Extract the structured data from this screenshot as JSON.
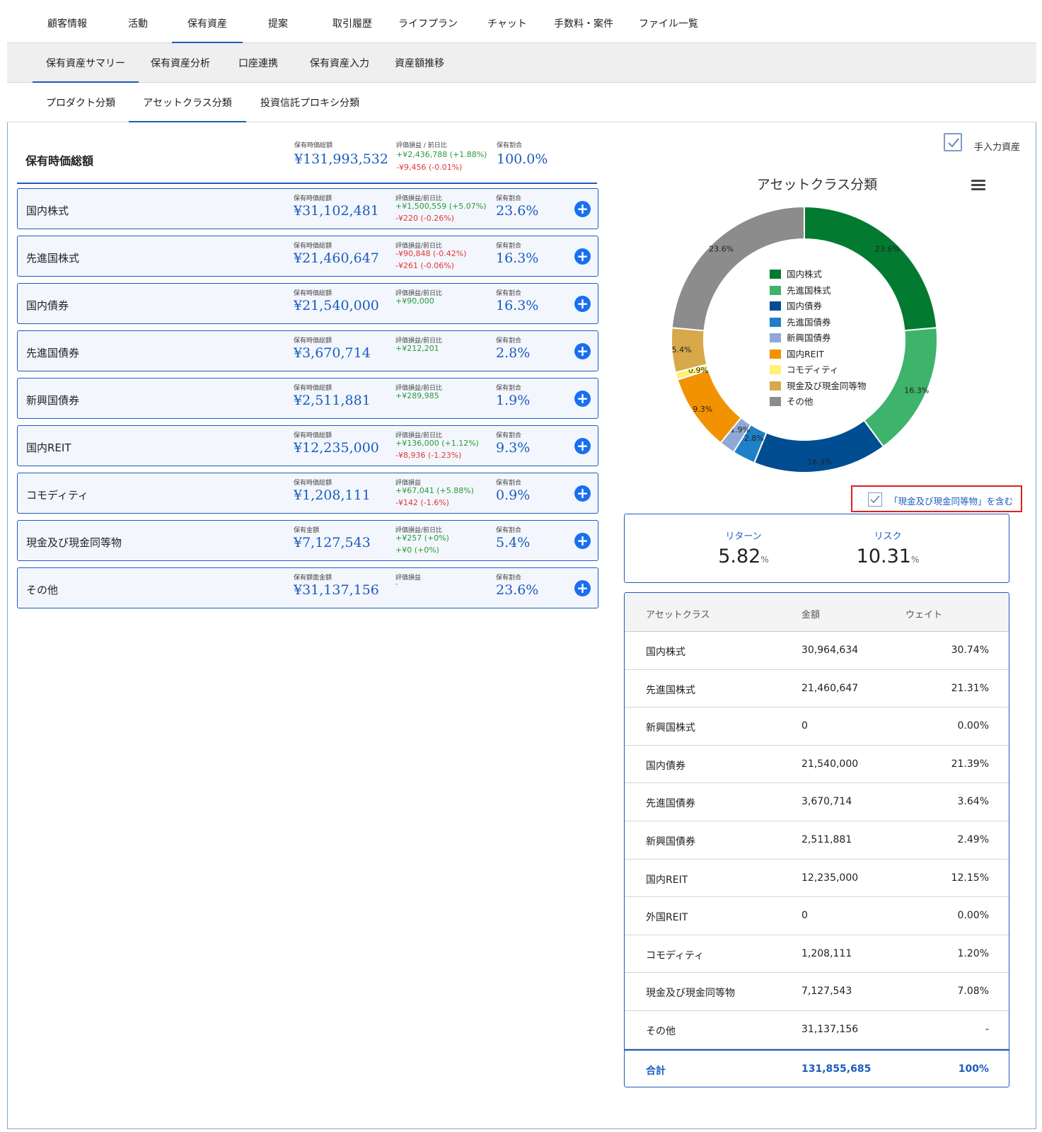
{
  "nav_main": [
    "顧客情報",
    "活動",
    "保有資産",
    "提案",
    "取引履歴",
    "ライフプラン",
    "チャット",
    "手数料・案件",
    "ファイル一覧"
  ],
  "nav_sub": [
    "保有資産サマリー",
    "保有資産分析",
    "口座連携",
    "保有資産入力",
    "資産額推移"
  ],
  "nav_class": [
    "プロダクト分類",
    "アセットクラス分類",
    "投資信託プロキシ分類"
  ],
  "total": {
    "label": "保有時価総額",
    "value_label": "保有時価総額",
    "value": "¥131,993,532",
    "pl_label": "評価損益 / 前日比",
    "pl": "+¥2,436,788 (+1.88%)",
    "day": "-¥9,456 (-0.01%)",
    "ratio_label": "保有割合",
    "ratio": "100.0%"
  },
  "assets": [
    {
      "name": "国内株式",
      "value_label": "保有時価総額",
      "value": "¥31,102,481",
      "pl_label": "評価損益/前日比",
      "pl": "+¥1,500,559 (+5.07%)",
      "day": "-¥220 (-0.26%)",
      "ratio_label": "保有割合",
      "ratio": "23.6%"
    },
    {
      "name": "先進国株式",
      "value_label": "保有時価総額",
      "value": "¥21,460,647",
      "pl_label": "評価損益/前日比",
      "pl": "-¥90,848 (-0.42%)",
      "pl_neg": true,
      "day": "-¥261 (-0.06%)",
      "ratio_label": "保有割合",
      "ratio": "16.3%"
    },
    {
      "name": "国内債券",
      "value_label": "保有時価総額",
      "value": "¥21,540,000",
      "pl_label": "評価損益/前日比",
      "pl": "+¥90,000",
      "day": "",
      "ratio_label": "保有割合",
      "ratio": "16.3%"
    },
    {
      "name": "先進国債券",
      "value_label": "保有時価総額",
      "value": "¥3,670,714",
      "pl_label": "評価損益/前日比",
      "pl": "+¥212,201",
      "day": "",
      "ratio_label": "保有割合",
      "ratio": "2.8%"
    },
    {
      "name": "新興国債券",
      "value_label": "保有時価総額",
      "value": "¥2,511,881",
      "pl_label": "評価損益/前日比",
      "pl": "+¥289,985",
      "day": "",
      "ratio_label": "保有割合",
      "ratio": "1.9%"
    },
    {
      "name": "国内REIT",
      "value_label": "保有時価総額",
      "value": "¥12,235,000",
      "pl_label": "評価損益/前日比",
      "pl": "+¥136,000 (+1.12%)",
      "day": "-¥8,936 (-1.23%)",
      "ratio_label": "保有割合",
      "ratio": "9.3%"
    },
    {
      "name": "コモディティ",
      "value_label": "保有時価総額",
      "value": "¥1,208,111",
      "pl_label": "評価損益",
      "pl": "+¥67,041 (+5.88%)",
      "day": "-¥142 (-1.6%)",
      "ratio_label": "保有割合",
      "ratio": "0.9%"
    },
    {
      "name": "現金及び現金同等物",
      "value_label": "保有金額",
      "value": "¥7,127,543",
      "pl_label": "評価損益/前日比",
      "pl": "+¥257 (+0%)",
      "day": "+¥0 (+0%)",
      "day_pos": true,
      "ratio_label": "保有割合",
      "ratio": "5.4%"
    },
    {
      "name": "その他",
      "value_label": "保有額面金額",
      "value": "¥31,137,156",
      "pl_label": "評価損益",
      "pl": "-",
      "pl_plain": true,
      "day": "",
      "ratio_label": "保有割合",
      "ratio": "23.6%"
    }
  ],
  "manual_label": "手入力資産",
  "cash_toggle_label": "「現金及び現金同等物」を含む",
  "chart_data": {
    "type": "pie",
    "title": "アセットクラス分類",
    "categories": [
      "国内株式",
      "先進国株式",
      "国内債券",
      "先進国債券",
      "新興国債券",
      "国内REIT",
      "コモディティ",
      "現金及び現金同等物",
      "その他"
    ],
    "values": [
      23.6,
      16.3,
      16.3,
      2.8,
      1.9,
      9.3,
      0.9,
      5.4,
      23.6
    ],
    "labels": [
      "23.6%",
      "16.3%",
      "16.3%",
      "2.8%",
      "1.9%",
      "9.3%",
      "0.9%",
      "5.4%",
      "23.6%"
    ],
    "colors": [
      "#027a30",
      "#3db36b",
      "#004d92",
      "#1f7fc7",
      "#8fa8d8",
      "#f39200",
      "#fff176",
      "#d8a94a",
      "#8c8c8c"
    ],
    "legend_position": "center"
  },
  "return_risk": {
    "return_label": "リターン",
    "return_value": "5.82",
    "return_unit": "%",
    "risk_label": "リスク",
    "risk_value": "10.31",
    "risk_unit": "%"
  },
  "table": {
    "headers": [
      "アセットクラス",
      "金額",
      "ウェイト"
    ],
    "rows": [
      [
        "国内株式",
        "30,964,634",
        "30.74%"
      ],
      [
        "先進国株式",
        "21,460,647",
        "21.31%"
      ],
      [
        "新興国株式",
        "0",
        "0.00%"
      ],
      [
        "国内債券",
        "21,540,000",
        "21.39%"
      ],
      [
        "先進国債券",
        "3,670,714",
        "3.64%"
      ],
      [
        "新興国債券",
        "2,511,881",
        "2.49%"
      ],
      [
        "国内REIT",
        "12,235,000",
        "12.15%"
      ],
      [
        "外国REIT",
        "0",
        "0.00%"
      ],
      [
        "コモディティ",
        "1,208,111",
        "1.20%"
      ],
      [
        "現金及び現金同等物",
        "7,127,543",
        "7.08%"
      ],
      [
        "その他",
        "31,137,156",
        "-"
      ]
    ],
    "total": [
      "合計",
      "131,855,685",
      "100%"
    ]
  }
}
